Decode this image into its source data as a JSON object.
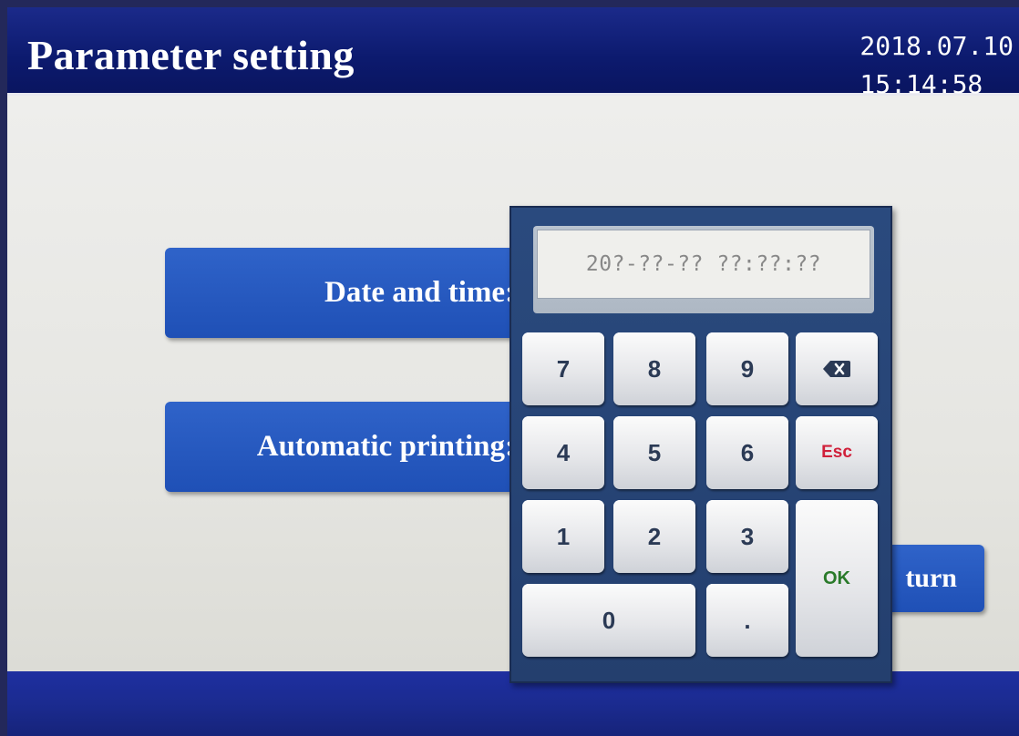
{
  "header": {
    "title": "Parameter setting",
    "date": "2018.07.10",
    "time": "15:14:58"
  },
  "fields": {
    "date_time_label": "Date and time:",
    "auto_print_label": "Automatic printing:"
  },
  "return_button": "turn",
  "keypad": {
    "display_value": "20?-??-?? ??:??:??",
    "keys": {
      "k7": "7",
      "k8": "8",
      "k9": "9",
      "k4": "4",
      "k5": "5",
      "k6": "6",
      "k1": "1",
      "k2": "2",
      "k3": "3",
      "k0": "0",
      "dot": ".",
      "esc": "Esc",
      "ok": "OK"
    },
    "backspace_icon": "backspace-icon"
  },
  "colors": {
    "header_bg": "#0c1a6e",
    "content_bg": "#e8e8e4",
    "label_blue": "#2457bd",
    "keypad_frame": "#26426f",
    "esc_red": "#d0203a",
    "ok_green": "#2a7a2a"
  }
}
